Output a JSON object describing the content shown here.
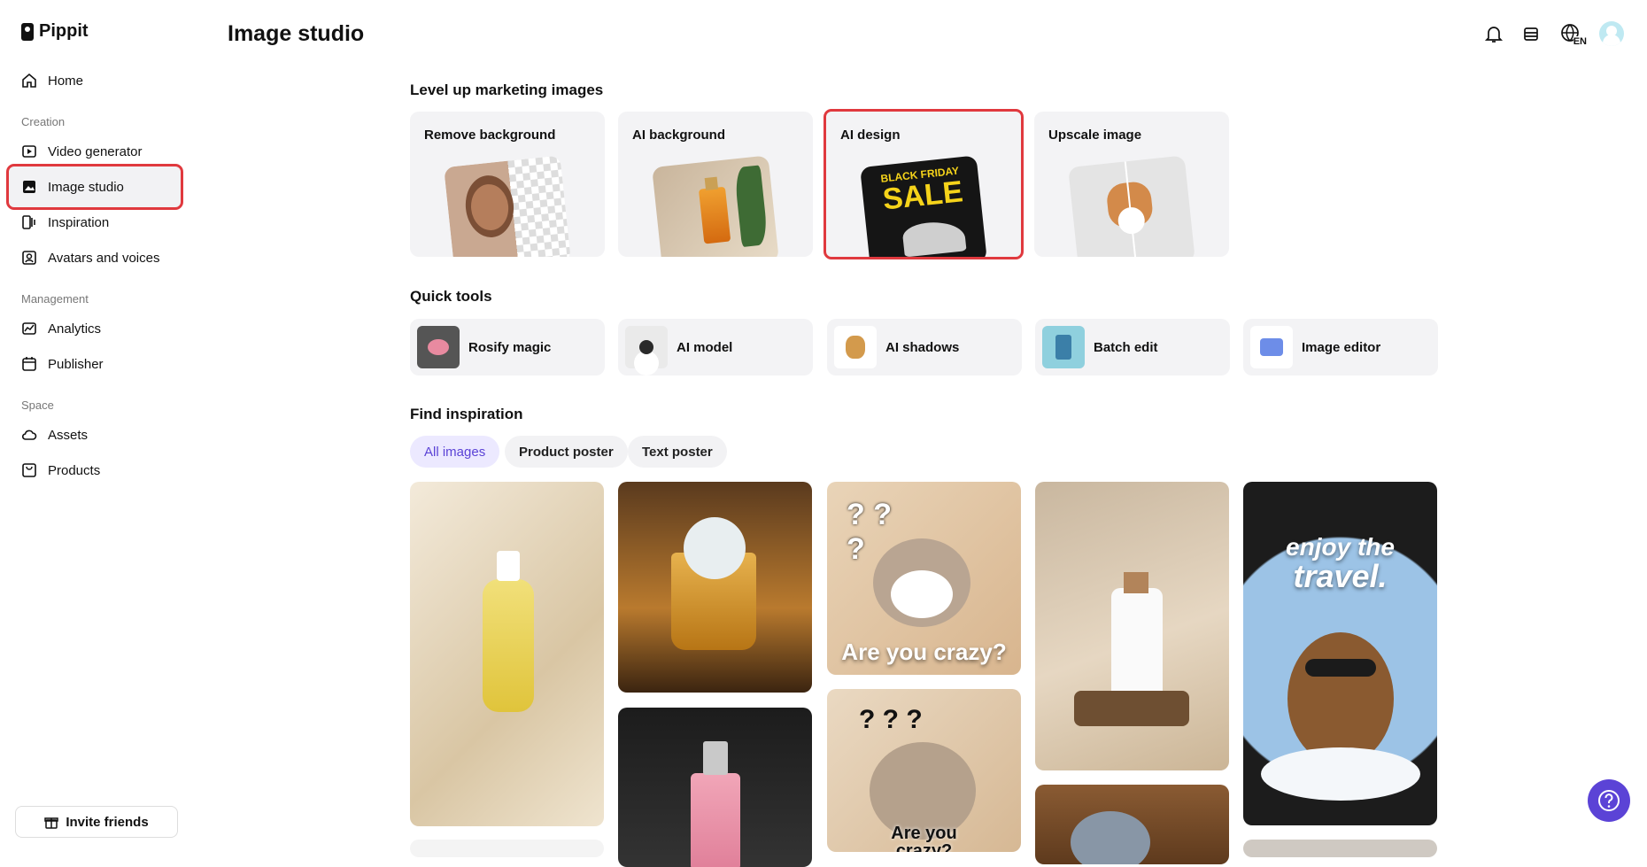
{
  "brand": {
    "name": "Pippit"
  },
  "header": {
    "title": "Image studio",
    "language": "EN"
  },
  "sidebar": {
    "home": "Home",
    "sections": {
      "creation": "Creation",
      "management": "Management",
      "space": "Space"
    },
    "items": {
      "video_generator": "Video generator",
      "image_studio": "Image studio",
      "inspiration": "Inspiration",
      "avatars": "Avatars and voices",
      "analytics": "Analytics",
      "publisher": "Publisher",
      "assets": "Assets",
      "products": "Products"
    },
    "invite": "Invite friends",
    "active_item": "Image studio"
  },
  "marketing": {
    "heading": "Level up marketing images",
    "cards": [
      {
        "label": "Remove background"
      },
      {
        "label": "AI background"
      },
      {
        "label": "AI design",
        "art_text_1": "BLACK FRIDAY",
        "art_text_2": "SALE"
      },
      {
        "label": "Upscale image"
      }
    ]
  },
  "quick_tools": {
    "heading": "Quick tools",
    "items": [
      {
        "label": "Rosify magic"
      },
      {
        "label": "AI model"
      },
      {
        "label": "AI shadows"
      },
      {
        "label": "Batch edit"
      },
      {
        "label": "Image editor"
      }
    ]
  },
  "inspiration": {
    "heading": "Find inspiration",
    "filters": [
      "All images",
      "Product poster",
      "Text poster"
    ],
    "active_filter": "All images",
    "texts": {
      "crazy_1": "Are you crazy?",
      "crazy_2_line1": "Are you",
      "crazy_2_line2": "crazy?",
      "travel_1": "enjoy the",
      "travel_2": "travel."
    }
  },
  "colors": {
    "accent": "#5b43d6",
    "highlight": "#e0393e",
    "card_bg": "#f3f3f5"
  }
}
